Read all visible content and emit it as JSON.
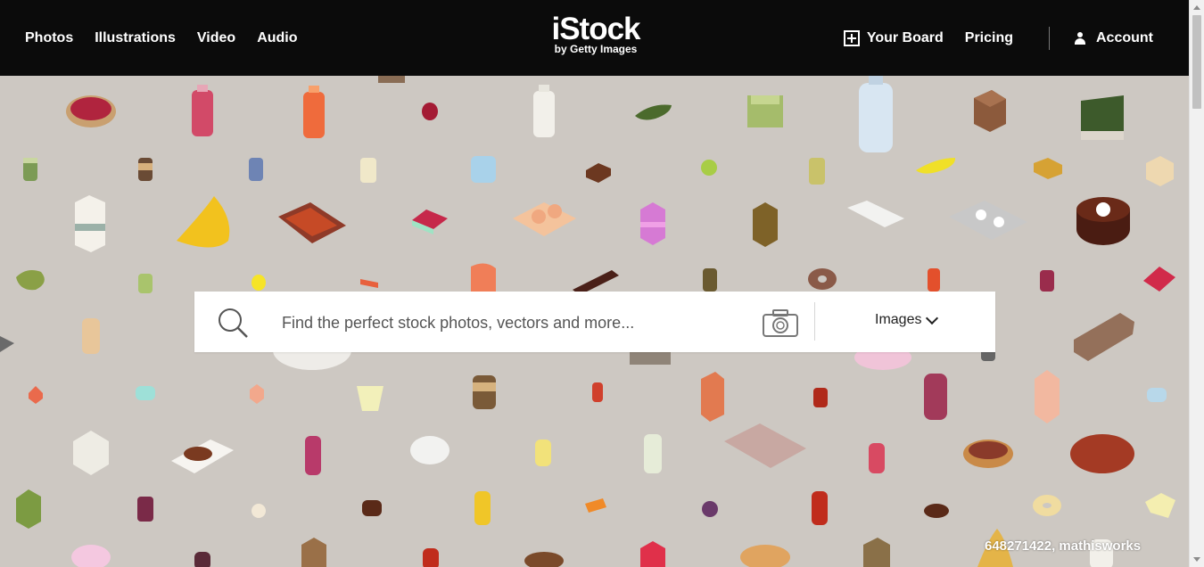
{
  "header": {
    "nav_left": [
      "Photos",
      "Illustrations",
      "Video",
      "Audio"
    ],
    "logo_main": "iStock",
    "logo_sub": "by Getty Images",
    "board_label": "Your Board",
    "pricing_label": "Pricing",
    "account_label": "Account"
  },
  "search": {
    "placeholder": "Find the perfect stock photos, vectors and more...",
    "value": "",
    "type_label": "Images"
  },
  "hero": {
    "credit": "648271422, mathisworks",
    "background_color": "#cdc8c2"
  },
  "colors": {
    "header_bg": "#0b0b0b",
    "header_text": "#ffffff"
  }
}
